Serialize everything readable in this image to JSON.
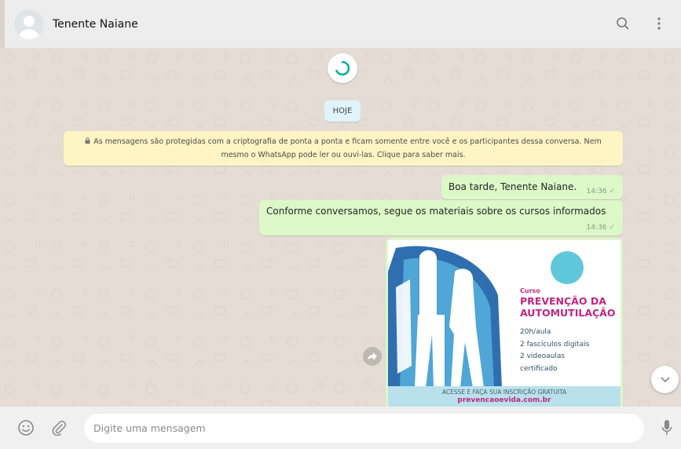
{
  "header": {
    "contact_name": "Tenente Naiane",
    "icons": [
      "avatar",
      "search-icon",
      "more-vertical-icon"
    ]
  },
  "chat": {
    "date_label": "HOJE",
    "encryption_notice": {
      "line1": "As mensagens são protegidas com a criptografia de ponta a ponta e ficam somente entre você e os participantes dessa conversa. Nem",
      "line2": "mesmo o WhatsApp pode ler ou ouvi-las. Clique para saber mais."
    },
    "messages": [
      {
        "text": "Boa tarde, Tenente Naiane.",
        "time": "14:36",
        "status": "✓"
      },
      {
        "text": "Conforme conversamos, segue os materiais sobre os cursos informados",
        "time": "14:36",
        "status": "✓"
      }
    ],
    "image_message": {
      "tag": "Curso",
      "title_line1": "PREVENÇÃO DA",
      "title_line2": "AUTOMUTILAÇÃO",
      "info": [
        "20h/aula",
        "2 fascículos digitais",
        "2 videoaulas",
        "certificado"
      ],
      "cta": "ACESSE E FAÇA SUA INSCRIÇÃO GRATUITA",
      "url": "prevencaoevida.com.br"
    }
  },
  "composer": {
    "placeholder": "Digite uma mensagem"
  },
  "colors": {
    "outgoing_bubble": "#dcf8c6",
    "notice_bg": "#fff5c4",
    "accent_pink": "#c1277f",
    "spinner": "#00af9c"
  }
}
